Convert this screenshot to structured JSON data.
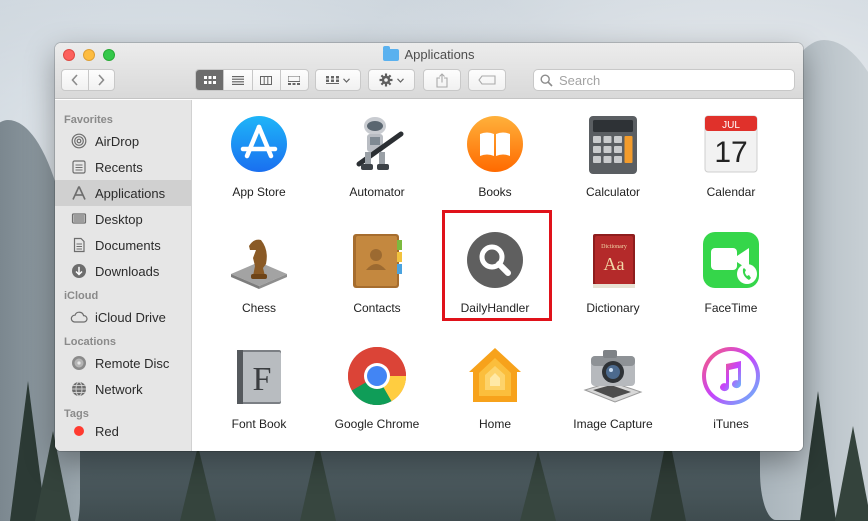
{
  "window": {
    "title": "Applications"
  },
  "toolbar": {
    "back_icon": "chevron-left-icon",
    "forward_icon": "chevron-right-icon",
    "view_modes": [
      "icon-view",
      "list-view",
      "column-view",
      "gallery-view"
    ],
    "active_view": "icon-view"
  },
  "search": {
    "placeholder": "Search",
    "value": ""
  },
  "sidebar": {
    "sections": [
      {
        "header": "Favorites",
        "items": [
          {
            "label": "AirDrop",
            "icon": "airdrop-icon"
          },
          {
            "label": "Recents",
            "icon": "recents-icon"
          },
          {
            "label": "Applications",
            "icon": "applications-icon",
            "active": true
          },
          {
            "label": "Desktop",
            "icon": "desktop-icon"
          },
          {
            "label": "Documents",
            "icon": "documents-icon"
          },
          {
            "label": "Downloads",
            "icon": "downloads-icon"
          }
        ]
      },
      {
        "header": "iCloud",
        "items": [
          {
            "label": "iCloud Drive",
            "icon": "cloud-icon"
          }
        ]
      },
      {
        "header": "Locations",
        "items": [
          {
            "label": "Remote Disc",
            "icon": "disc-icon"
          },
          {
            "label": "Network",
            "icon": "network-icon"
          }
        ]
      },
      {
        "header": "Tags",
        "items": [
          {
            "label": "Red",
            "icon": "red-tag-icon"
          }
        ]
      }
    ]
  },
  "apps": [
    {
      "name": "App Store",
      "icon": "app-store-icon"
    },
    {
      "name": "Automator",
      "icon": "automator-icon"
    },
    {
      "name": "Books",
      "icon": "books-icon"
    },
    {
      "name": "Calculator",
      "icon": "calculator-icon"
    },
    {
      "name": "Calendar",
      "icon": "calendar-icon",
      "month": "JUL",
      "day": "17"
    },
    {
      "name": "Chess",
      "icon": "chess-icon"
    },
    {
      "name": "Contacts",
      "icon": "contacts-icon"
    },
    {
      "name": "DailyHandler",
      "icon": "dailyhandler-icon",
      "highlighted": true
    },
    {
      "name": "Dictionary",
      "icon": "dictionary-icon",
      "cover_text": "Dictionary",
      "glyph": "Aa"
    },
    {
      "name": "FaceTime",
      "icon": "facetime-icon"
    },
    {
      "name": "Font Book",
      "icon": "font-book-icon",
      "glyph": "F"
    },
    {
      "name": "Google Chrome",
      "icon": "chrome-icon"
    },
    {
      "name": "Home",
      "icon": "home-icon"
    },
    {
      "name": "Image Capture",
      "icon": "image-capture-icon"
    },
    {
      "name": "iTunes",
      "icon": "itunes-icon"
    }
  ],
  "colors": {
    "highlight": "#e0121a",
    "close": "#fc605c",
    "minimize": "#fdbc40",
    "maximize": "#34c84a"
  }
}
